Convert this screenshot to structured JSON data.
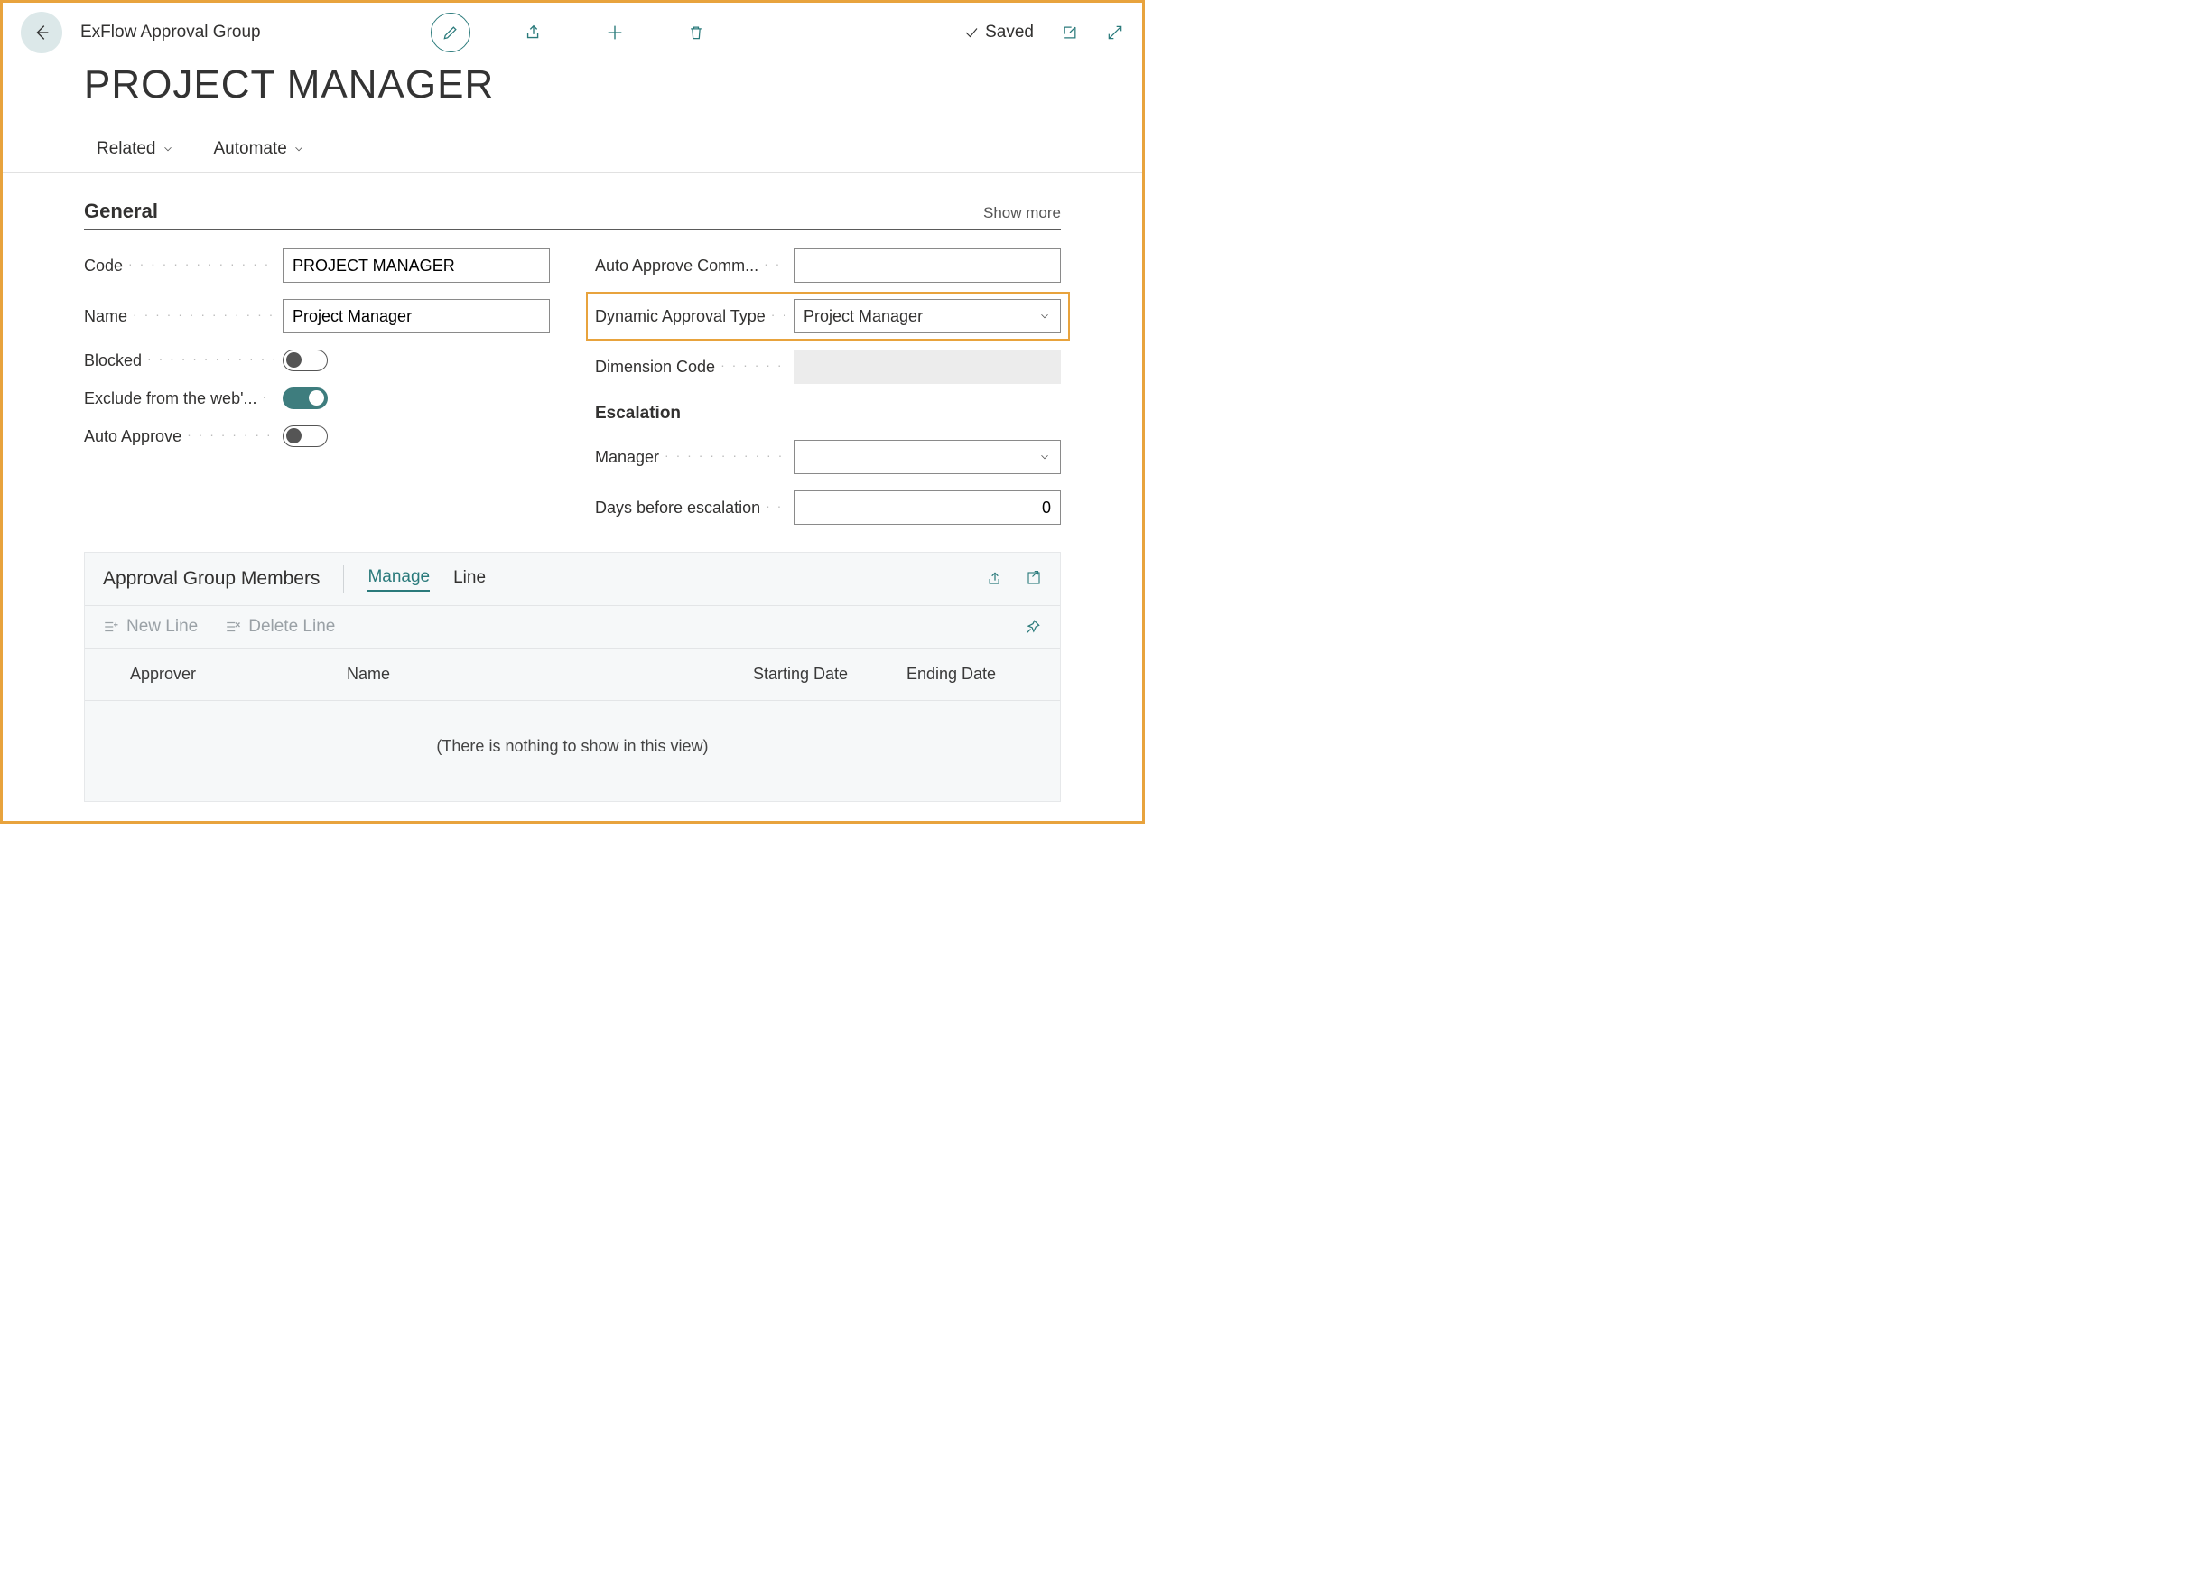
{
  "header": {
    "breadcrumb": "ExFlow Approval Group",
    "saved_label": "Saved"
  },
  "page_title": "PROJECT MANAGER",
  "menu": {
    "related": "Related",
    "automate": "Automate"
  },
  "section_general": {
    "title": "General",
    "show_more": "Show more"
  },
  "fields": {
    "code_label": "Code",
    "code_value": "PROJECT MANAGER",
    "name_label": "Name",
    "name_value": "Project Manager",
    "blocked_label": "Blocked",
    "blocked_on": false,
    "exclude_label": "Exclude from the web'...",
    "exclude_on": true,
    "auto_approve_label": "Auto Approve",
    "auto_approve_on": false,
    "auto_approve_comm_label": "Auto Approve Comm...",
    "auto_approve_comm_value": "",
    "dynamic_type_label": "Dynamic Approval Type",
    "dynamic_type_value": "Project Manager",
    "dimension_code_label": "Dimension Code",
    "escalation_heading": "Escalation",
    "manager_label": "Manager",
    "manager_value": "",
    "days_label": "Days before escalation",
    "days_value": "0"
  },
  "members": {
    "card_title": "Approval Group Members",
    "tab_manage": "Manage",
    "tab_line": "Line",
    "new_line": "New Line",
    "delete_line": "Delete Line",
    "columns": {
      "approver": "Approver",
      "name": "Name",
      "starting": "Starting Date",
      "ending": "Ending Date"
    },
    "empty": "(There is nothing to show in this view)"
  }
}
